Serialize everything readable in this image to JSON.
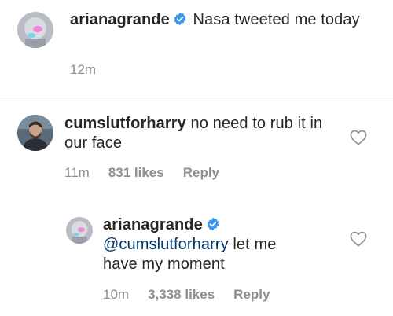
{
  "caption": {
    "username": "arianagrande",
    "text": "Nasa tweeted me today",
    "time": "12m"
  },
  "comment": {
    "username": "cumslutforharry",
    "text": "no need to rub it in our face",
    "time": "11m",
    "likes": "831 likes",
    "reply_label": "Reply"
  },
  "reply": {
    "username": "arianagrande",
    "mention": "@cumslutforharry",
    "text": "let me have my moment",
    "time": "10m",
    "likes": "3,338 likes",
    "reply_label": "Reply"
  },
  "colors": {
    "text": "#262626",
    "muted": "#8e8e8e",
    "mention": "#00376b",
    "verified": "#3897f0",
    "divider": "#dbdbdb"
  },
  "icons": [
    "verified-badge-icon",
    "heart-icon"
  ]
}
